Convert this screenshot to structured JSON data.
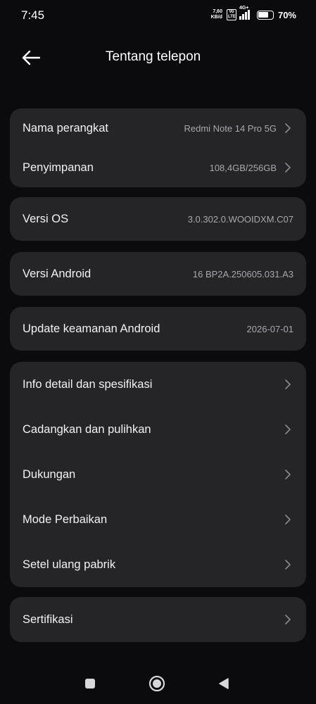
{
  "status_bar": {
    "time": "7:45",
    "net_speed_value": "7,60",
    "net_speed_unit": "KB/d",
    "volte_top": "Vo",
    "volte_bottom": "LTE",
    "network_type": "4G+",
    "battery_percent": "70%",
    "battery_level": 0.7
  },
  "header": {
    "title": "Tentang telepon"
  },
  "device": {
    "name_label": "Nama perangkat",
    "name_value": "Redmi Note 14 Pro 5G",
    "storage_label": "Penyimpanan",
    "storage_value": "108,4GB/256GB"
  },
  "os": {
    "label": "Versi OS",
    "value": "3.0.302.0.WOOIDXM.C07"
  },
  "android": {
    "label": "Versi Android",
    "value": "16 BP2A.250605.031.A3"
  },
  "security": {
    "label": "Update keamanan Android",
    "value": "2026-07-01"
  },
  "menu": {
    "items": [
      {
        "label": "Info detail dan spesifikasi"
      },
      {
        "label": "Cadangkan dan pulihkan"
      },
      {
        "label": "Dukungan"
      },
      {
        "label": "Mode Perbaikan"
      },
      {
        "label": "Setel ulang pabrik"
      }
    ]
  },
  "certification": {
    "label": "Sertifikasi"
  },
  "colors": {
    "background": "#0b0b0e",
    "card": "#252528",
    "text_primary": "#f2f2f2",
    "text_secondary": "#a8a8ac"
  },
  "icons": {
    "back": "arrow-left-icon",
    "chevron": "chevron-right-icon",
    "nav_recents": "square-icon",
    "nav_home": "circle-icon",
    "nav_back": "triangle-icon"
  }
}
